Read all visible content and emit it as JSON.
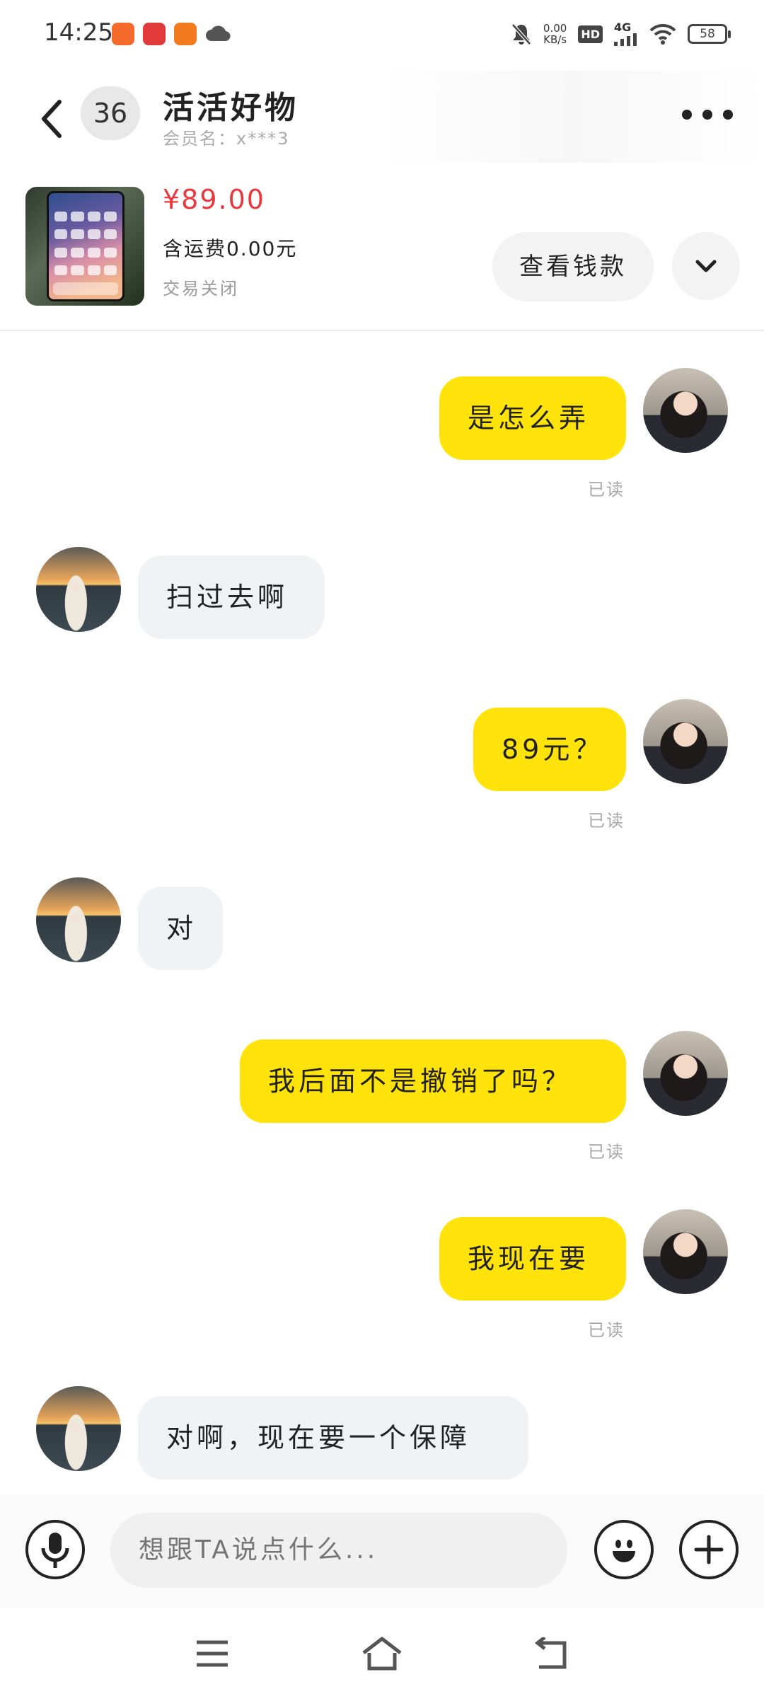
{
  "status_bar": {
    "time": "14:25",
    "net_speed_value": "0.00",
    "net_speed_unit": "KB/s",
    "hd": "HD",
    "signal": "4G",
    "battery": "58"
  },
  "header": {
    "unread_count": "36",
    "title": "活活好物",
    "member_label": "会员名：x***3"
  },
  "product": {
    "price": "¥89.00",
    "shipping": "含运费0.00元",
    "status": "交易关闭",
    "view_button": "查看钱款"
  },
  "messages": [
    {
      "from": "me",
      "text": "是怎么弄",
      "read": "已读"
    },
    {
      "from": "other",
      "text": "扫过去啊"
    },
    {
      "from": "me",
      "text": "89元？",
      "read": "已读"
    },
    {
      "from": "other",
      "text": "对"
    },
    {
      "from": "me",
      "text": "我后面不是撤销了吗？",
      "read": "已读"
    },
    {
      "from": "me",
      "text": "我现在要",
      "read": "已读"
    },
    {
      "from": "other",
      "text": "对啊，现在要一个保障"
    }
  ],
  "composer": {
    "placeholder": "想跟TA说点什么..."
  },
  "colors": {
    "my_bubble": "#ffe30a",
    "other_bubble": "#f1f2f4",
    "price": "#e8383d"
  },
  "icons": [
    "back-icon",
    "more-icon",
    "chevron-down-icon",
    "microphone-icon",
    "emoji-icon",
    "plus-icon",
    "menu-icon",
    "home-icon",
    "return-icon"
  ]
}
